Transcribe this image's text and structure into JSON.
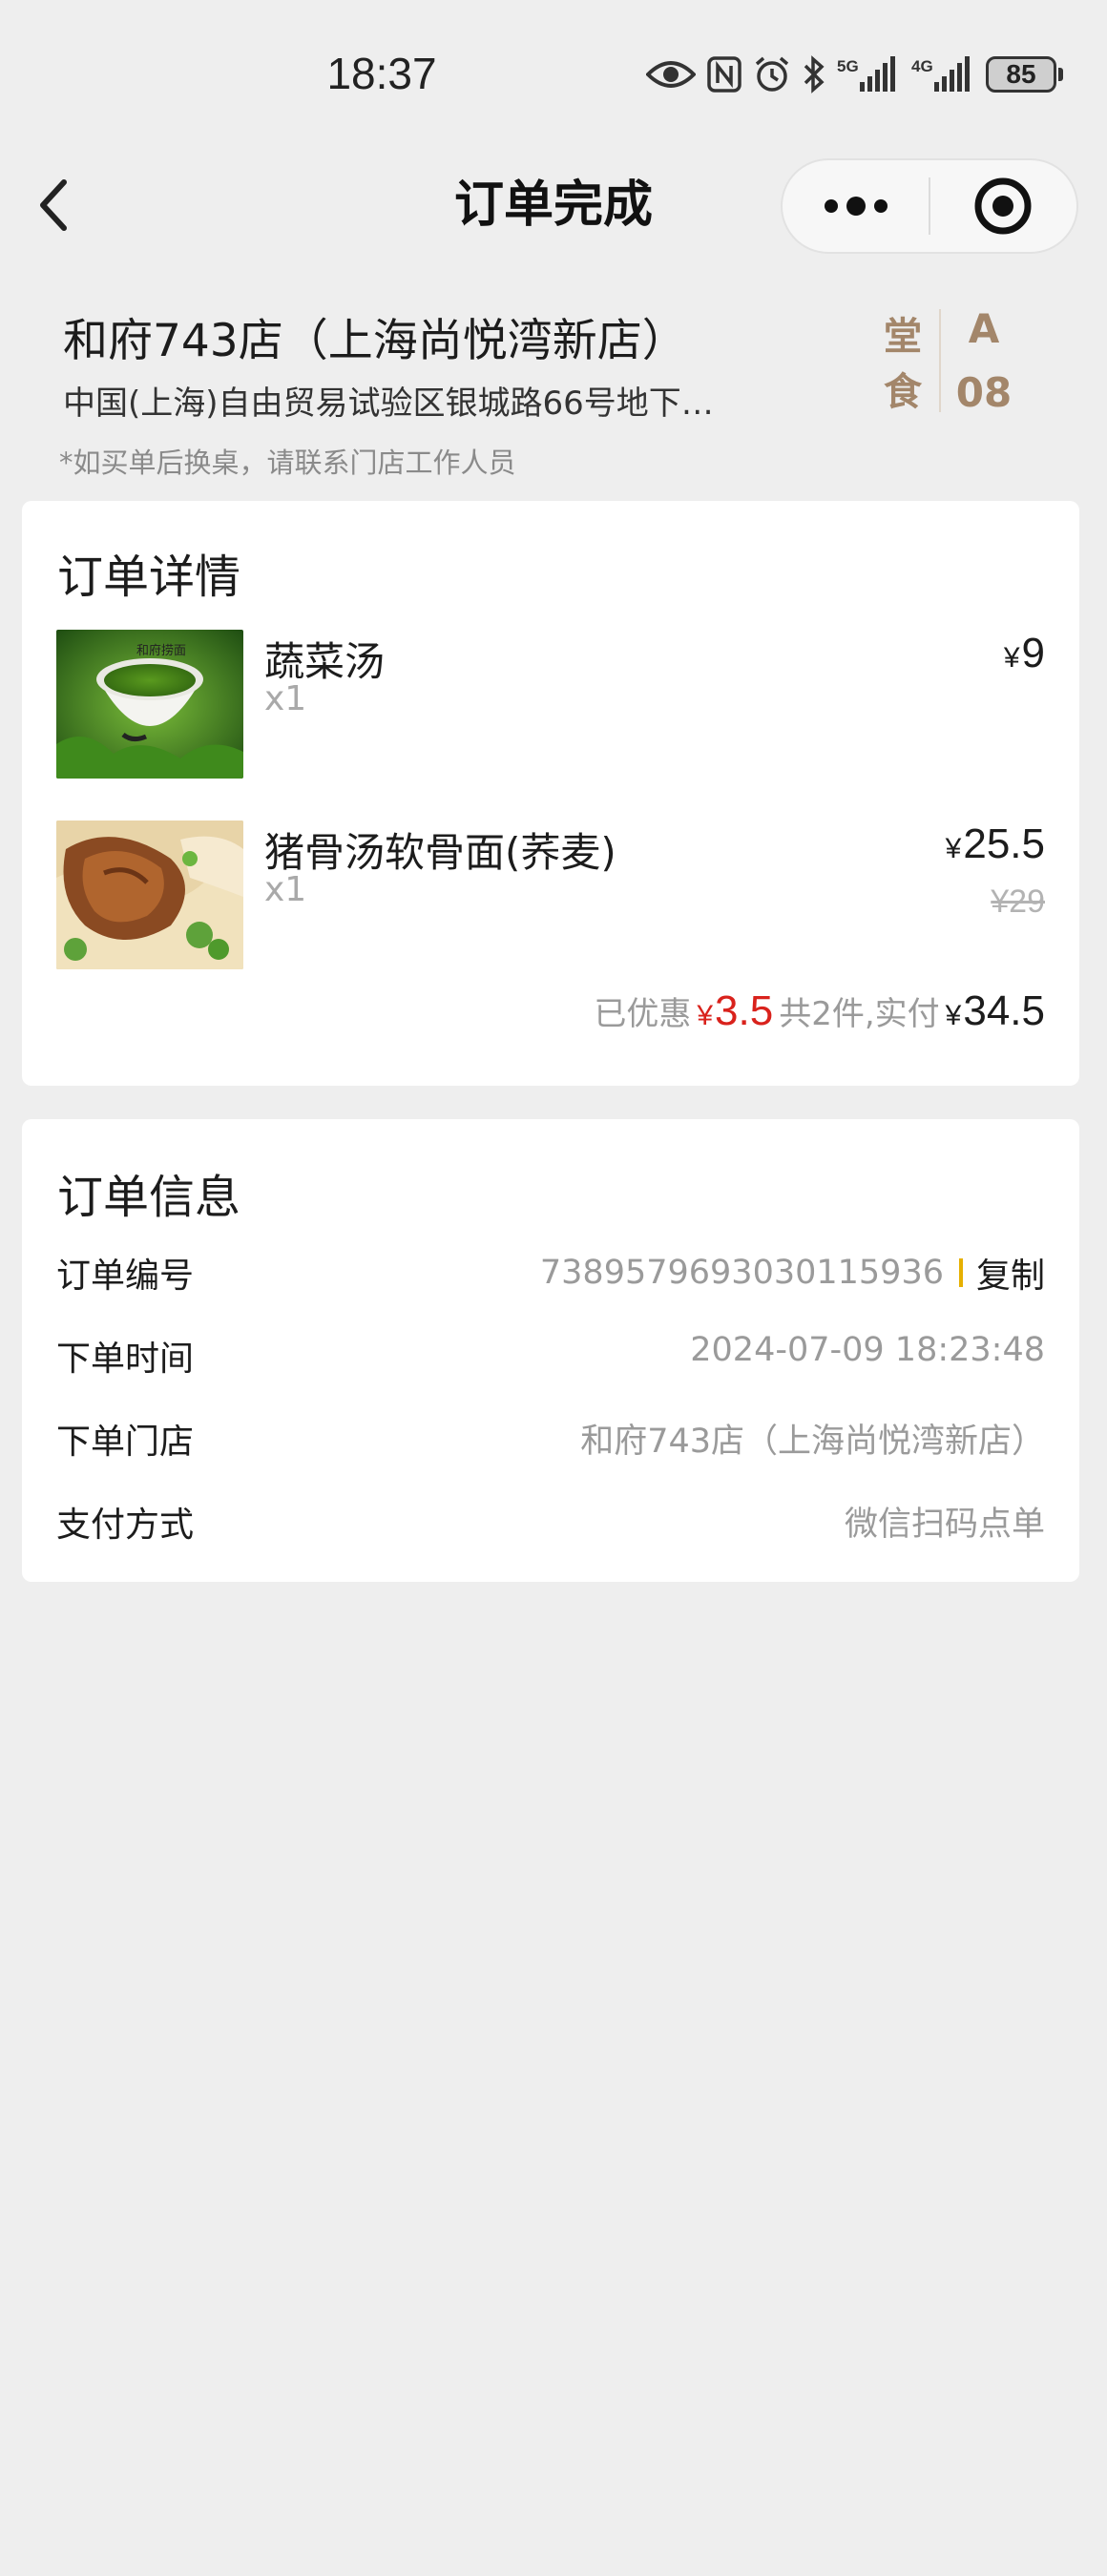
{
  "status_bar": {
    "time": "18:37",
    "network_5g": "5G",
    "network_4g": "4G",
    "battery": "85",
    "icons": [
      "eye-icon",
      "nfc-icon",
      "alarm-icon",
      "bluetooth-icon",
      "signal-5g-icon",
      "signal-4g-icon",
      "battery-icon"
    ]
  },
  "nav": {
    "title": "订单完成",
    "back_icon": "chevron-left-icon",
    "more_icon": "more-dots-icon",
    "close_icon": "target-close-icon"
  },
  "store": {
    "name": "和府743店（上海尚悦湾新店）",
    "address": "中国(上海)自由贸易试验区银城路66号地下…",
    "dine_type_line1": "堂",
    "dine_type_line2": "食",
    "table_line1": "A",
    "table_line2": "08",
    "notice": "*如买单后换桌，请联系门店工作人员"
  },
  "order_detail": {
    "title": "订单详情",
    "currency": "¥",
    "items": [
      {
        "name": "蔬菜汤",
        "qty": "x1",
        "price": "9",
        "original_price": ""
      },
      {
        "name": "猪骨汤软骨面(荞麦)",
        "qty": "x1",
        "price": "25.5",
        "original_price": "¥29"
      }
    ],
    "summary": {
      "discount_label": "已优惠",
      "discount": "3.5",
      "count_label": "共2件,实付",
      "total": "34.5"
    }
  },
  "order_info": {
    "title": "订单信息",
    "rows": [
      {
        "label": "订单编号",
        "value": "7389579693030115936",
        "action": "复制"
      },
      {
        "label": "下单时间",
        "value": "2024-07-09 18:23:48"
      },
      {
        "label": "下单门店",
        "value": "和府743店（上海尚悦湾新店）"
      },
      {
        "label": "支付方式",
        "value": "微信扫码点单"
      }
    ]
  },
  "colors": {
    "background": "#eeeeee",
    "accent_gold": "#a3866a",
    "discount_red": "#d9221c",
    "copy_divider": "#e6b000"
  }
}
